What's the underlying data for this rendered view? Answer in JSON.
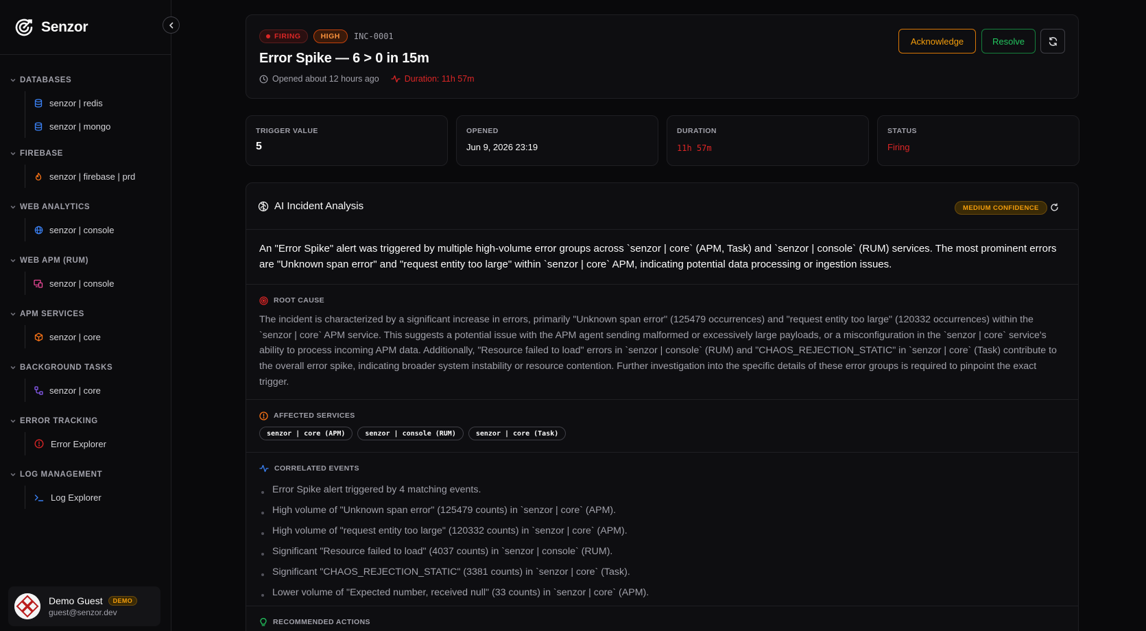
{
  "app": {
    "brand": "Senzor"
  },
  "sidebar": {
    "sections": [
      {
        "title": "DATABASES",
        "items": [
          {
            "label": "senzor | redis",
            "icon": "database-icon"
          },
          {
            "label": "senzor | mongo",
            "icon": "database-icon"
          }
        ]
      },
      {
        "title": "FIREBASE",
        "items": [
          {
            "label": "senzor | firebase | prd",
            "icon": "flame-icon"
          }
        ]
      },
      {
        "title": "WEB ANALYTICS",
        "items": [
          {
            "label": "senzor | console",
            "icon": "globe-icon"
          }
        ]
      },
      {
        "title": "WEB APM (RUM)",
        "items": [
          {
            "label": "senzor | console",
            "icon": "monitor-icon"
          }
        ]
      },
      {
        "title": "APM SERVICES",
        "items": [
          {
            "label": "senzor | core",
            "icon": "box-icon"
          }
        ]
      },
      {
        "title": "BACKGROUND TASKS",
        "items": [
          {
            "label": "senzor | core",
            "icon": "workflow-icon"
          }
        ]
      },
      {
        "title": "ERROR TRACKING",
        "items": [
          {
            "label": "Error Explorer",
            "icon": "alert-circle-icon"
          }
        ]
      },
      {
        "title": "LOG MANAGEMENT",
        "items": [
          {
            "label": "Log Explorer",
            "icon": "terminal-icon"
          }
        ]
      }
    ],
    "user": {
      "name": "Demo Guest",
      "badge": "DEMO",
      "email": "guest@senzor.dev"
    }
  },
  "incident": {
    "status_badge": "FIRING",
    "severity_badge": "HIGH",
    "id": "INC-0001",
    "title": "Error Spike — 6 > 0 in 15m",
    "opened_text": "Opened about 12 hours ago",
    "duration_text": "Duration: 11h 57m",
    "actions": {
      "acknowledge": "Acknowledge",
      "resolve": "Resolve"
    }
  },
  "stats": [
    {
      "label": "TRIGGER VALUE",
      "value": "5"
    },
    {
      "label": "OPENED",
      "value": "Jun 9, 2026 23:19"
    },
    {
      "label": "DURATION",
      "value": "11h 57m"
    },
    {
      "label": "STATUS",
      "value": "Firing"
    }
  ],
  "analysis": {
    "title": "AI Incident Analysis",
    "confidence": "MEDIUM CONFIDENCE",
    "summary": "An \"Error Spike\" alert was triggered by multiple high-volume error groups across `senzor | core` (APM, Task) and `senzor | console` (RUM) services. The most prominent errors are \"Unknown span error\" and \"request entity too large\" within `senzor | core` APM, indicating potential data processing or ingestion issues.",
    "root_cause_title": "ROOT CAUSE",
    "root_cause": "The incident is characterized by a significant increase in errors, primarily \"Unknown span error\" (125479 occurrences) and \"request entity too large\" (120332 occurrences) within the `senzor | core` APM service. This suggests a potential issue with the APM agent sending malformed or excessively large payloads, or a misconfiguration in the `senzor | core` service's ability to process incoming APM data. Additionally, \"Resource failed to load\" errors in `senzor | console` (RUM) and \"CHAOS_REJECTION_STATIC\" in `senzor | core` (Task) contribute to the overall error spike, indicating broader system instability or resource contention. Further investigation into the specific details of these error groups is required to pinpoint the exact trigger.",
    "affected_title": "AFFECTED SERVICES",
    "affected_services": [
      "senzor | core (APM)",
      "senzor | console (RUM)",
      "senzor | core (Task)"
    ],
    "correlated_title": "CORRELATED EVENTS",
    "correlated_events": [
      "Error Spike alert triggered by 4 matching events.",
      "High volume of \"Unknown span error\" (125479 counts) in `senzor | core` (APM).",
      "High volume of \"request entity too large\" (120332 counts) in `senzor | core` (APM).",
      "Significant \"Resource failed to load\" (4037 counts) in `senzor | console` (RUM).",
      "Significant \"CHAOS_REJECTION_STATIC\" (3381 counts) in `senzor | core` (Task).",
      "Lower volume of \"Expected number, received null\" (33 counts) in `senzor | core` (APM)."
    ],
    "recommended_title": "RECOMMENDED ACTIONS"
  },
  "colors": {
    "firing": "#dc2626",
    "high": "#fb923c",
    "acknowledge": "#f59e0b",
    "resolve": "#22c55e",
    "background": "#09090b"
  }
}
